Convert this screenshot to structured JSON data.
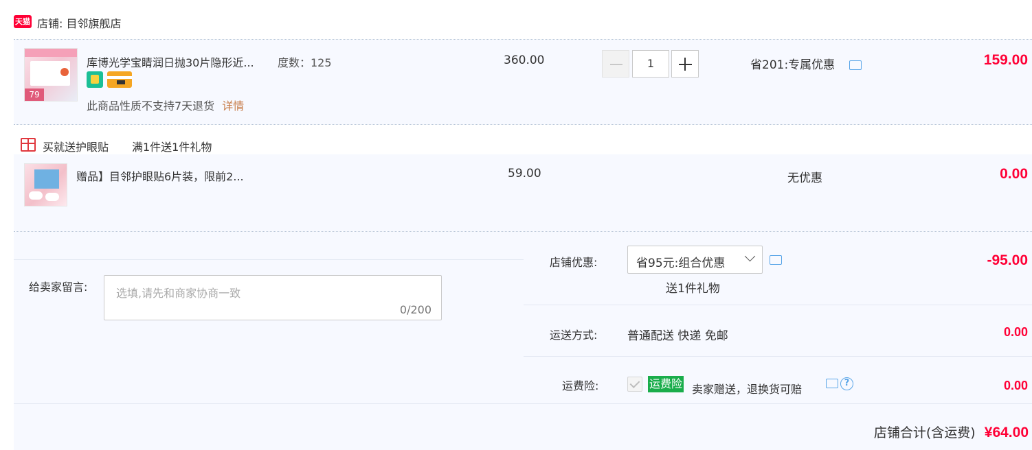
{
  "shop": {
    "logo_text": "天猫",
    "label": "店铺: 目邻旗舰店"
  },
  "item": {
    "title": "库博光学宝睛润日抛30片隐形近...",
    "spec": "度数：125",
    "badge_number": "79",
    "price": "360.00",
    "quantity": "1",
    "discount_text": "省201:专属优惠",
    "subtotal": "159.00",
    "notice": "此商品性质不支持7天退货",
    "notice_link": "详情"
  },
  "gift_promo": {
    "label": "买就送护眼贴",
    "rule": "满1件送1件礼物"
  },
  "gift_item": {
    "title": "赠品】目邻护眼贴6片装，限前2...",
    "price": "59.00",
    "discount_text": "无优惠",
    "subtotal": "0.00"
  },
  "seller_message": {
    "label": "给卖家留言:",
    "placeholder": "选填,请先和商家协商一致",
    "counter": "0/200"
  },
  "shop_discount": {
    "label": "店铺优惠:",
    "selected": "省95元:组合优惠",
    "sub": "送1件礼物",
    "amount": "-95.00"
  },
  "shipping": {
    "label": "运送方式:",
    "value": "普通配送 快递 免邮",
    "amount": "0.00"
  },
  "insurance": {
    "label": "运费险:",
    "tag": "运费险",
    "text": "卖家赠送，退换货可赔",
    "amount": "0.00"
  },
  "total": {
    "label": "店铺合计(含运费)",
    "value": "¥64.00"
  },
  "colors": {
    "price_red": "#ff0036",
    "tag_green": "#1aad4b",
    "tmall_red": "#ff0036",
    "link_orange": "#c77c48"
  }
}
